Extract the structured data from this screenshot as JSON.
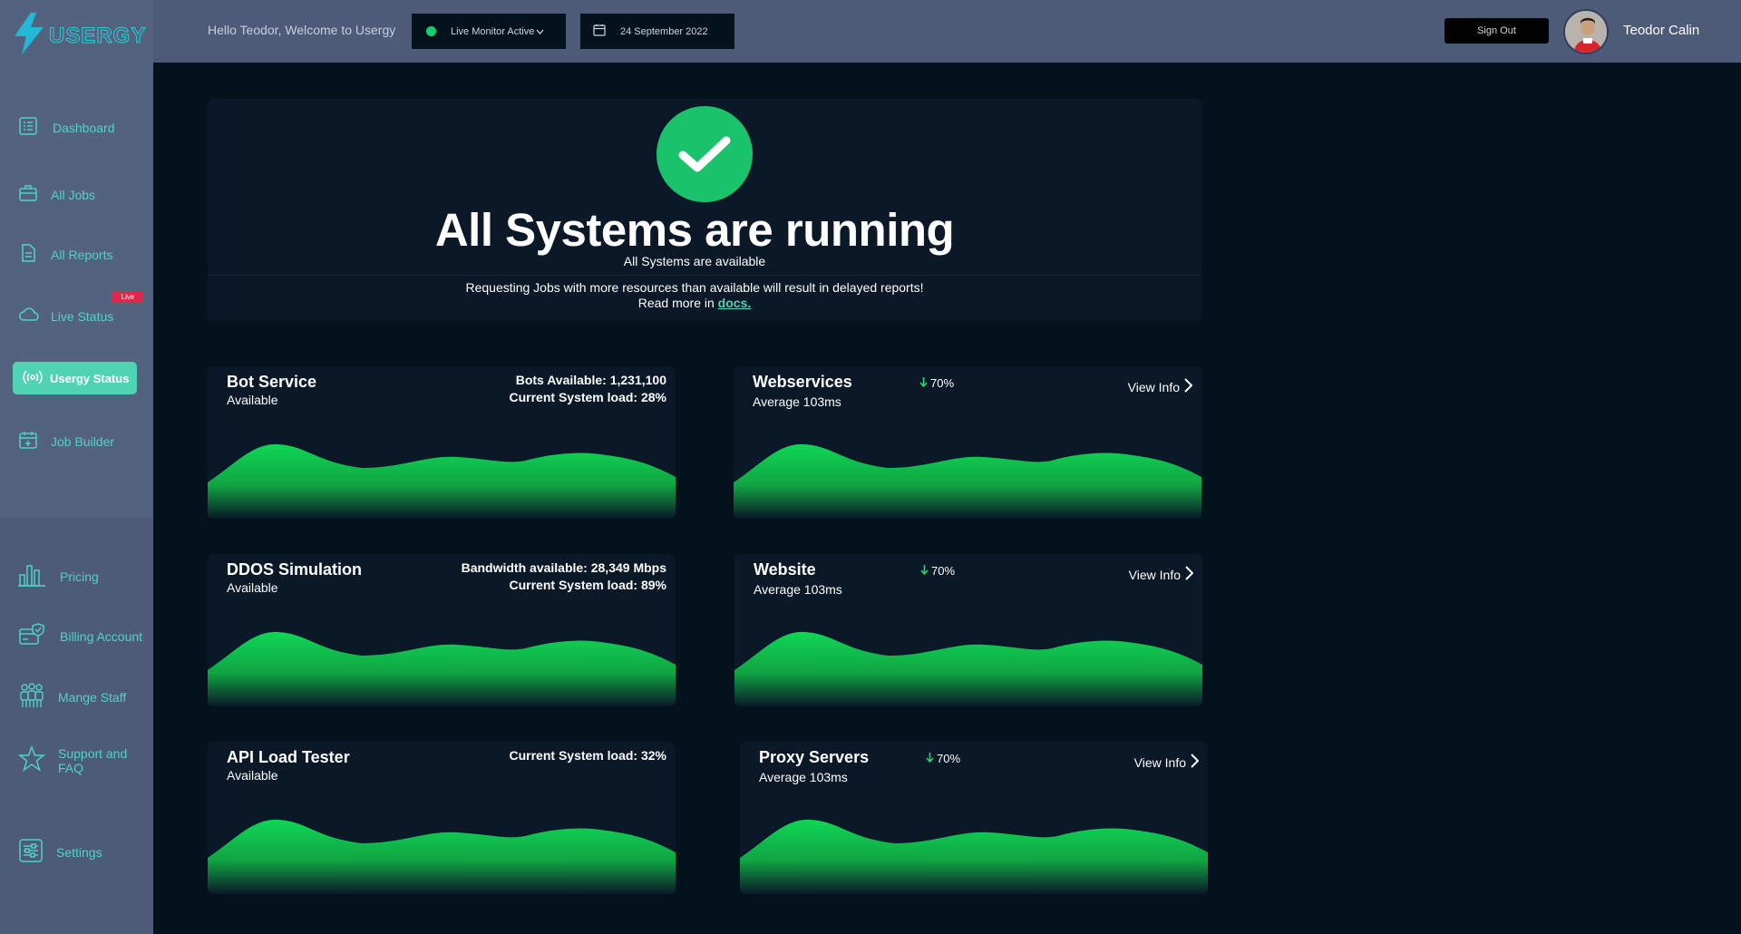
{
  "brand": {
    "name": "USERGY"
  },
  "header": {
    "greeting": "Hello Teodor, Welcome to Usergy",
    "monitor_label": "Live Monitor Active",
    "date": "24 September 2022",
    "signout_label": "Sign Out",
    "user_name": "Teodor Calin"
  },
  "sidebar": {
    "items": [
      {
        "label": "Dashboard",
        "icon": "list-icon"
      },
      {
        "label": "All Jobs",
        "icon": "briefcase-icon"
      },
      {
        "label": "All Reports",
        "icon": "document-icon"
      },
      {
        "label": "Live Status",
        "icon": "cloud-icon",
        "badge": "Live"
      },
      {
        "label": "Usergy Status",
        "icon": "broadcast-icon",
        "active": true
      },
      {
        "label": "Job Builder",
        "icon": "calendar-plus-icon"
      }
    ],
    "bottom_items": [
      {
        "label": "Pricing",
        "icon": "bar-chart-icon"
      },
      {
        "label": "Billing Account",
        "icon": "billing-icon"
      },
      {
        "label": "Mange Staff",
        "icon": "staff-icon"
      },
      {
        "label": "Support and FAQ",
        "icon": "star-icon"
      },
      {
        "label": "Settings",
        "icon": "sliders-icon"
      }
    ]
  },
  "hero": {
    "title": "All Systems are running",
    "subtitle": "All Systems are available",
    "note_line1": "Requesting Jobs with more resources than available will result in delayed reports!",
    "note_line2": "Read more in",
    "note_link": "docs."
  },
  "cards": [
    {
      "title": "Bot Service",
      "status": "Available",
      "metric1": "Bots Available: 1,231,100",
      "metric2": "Current System load: 28%"
    },
    {
      "title": "Webservices",
      "trend": "70%",
      "average": "Average 103ms",
      "action": "View Info"
    },
    {
      "title": "DDOS Simulation",
      "status": "Available",
      "metric1": "Bandwidth available: 28,349 Mbps",
      "metric2": "Current System load: 89%"
    },
    {
      "title": "Website",
      "trend": "70%",
      "average": "Average 103ms",
      "action": "View Info"
    },
    {
      "title": "API Load Tester",
      "status": "Available",
      "metric1": "Current System load: 32%"
    },
    {
      "title": "Proxy Servers",
      "trend": "70%",
      "average": "Average 103ms",
      "action": "View Info"
    }
  ],
  "colors": {
    "accent": "#4fd3b3",
    "success": "#1ac26b",
    "badge": "#e2264b",
    "background": "#03121d",
    "panel": "#0a1827"
  }
}
